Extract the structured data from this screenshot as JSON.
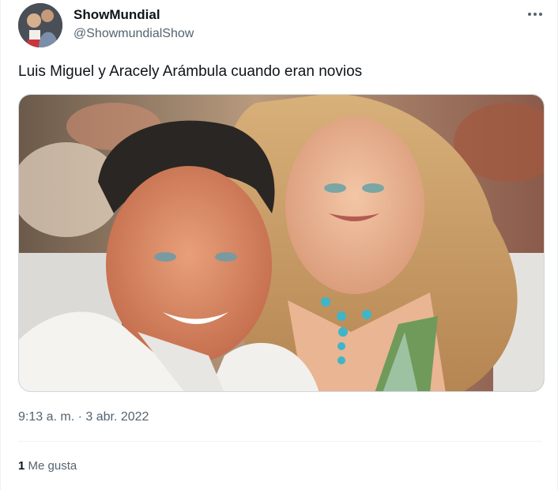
{
  "author": {
    "display_name": "ShowMundial",
    "handle": "@ShowmundialShow",
    "avatar": "profile-avatar"
  },
  "menu": {
    "icon": "more-horizontal-icon"
  },
  "tweet": {
    "text": "Luis Miguel y Aracely Arámbula cuando eran novios",
    "media": "photo"
  },
  "meta": {
    "timestamp": "9:13 a. m. · 3 abr. 2022"
  },
  "engagement": {
    "likes_count": "1",
    "likes_label": "Me gusta"
  },
  "colors": {
    "text_primary": "#0f1419",
    "text_secondary": "#536471",
    "border": "#eff3f4"
  }
}
